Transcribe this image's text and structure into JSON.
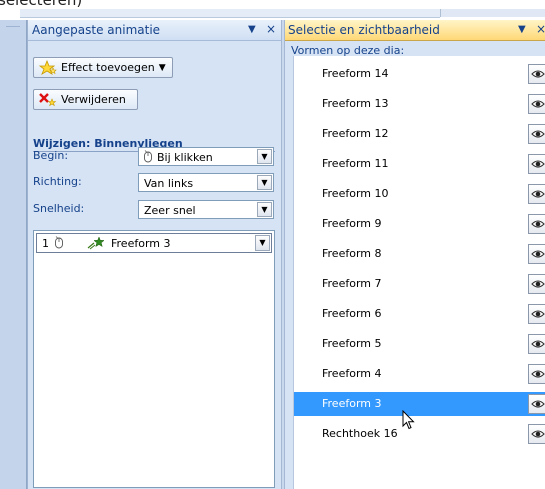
{
  "top_strip": {
    "cut_text": "selecteren)"
  },
  "animation_pane": {
    "title": "Aangepaste animatie",
    "add_effect_label": "Effect toevoegen",
    "remove_label": "Verwijderen",
    "section_title": "Wijzigen: Binnenvliegen",
    "properties": [
      {
        "label": "Begin:",
        "value": "Bij klikken"
      },
      {
        "label": "Richting:",
        "value": "Van links"
      },
      {
        "label": "Snelheid:",
        "value": "Zeer snel"
      }
    ],
    "effects": [
      {
        "number": "1",
        "name": "Freeform 3"
      }
    ]
  },
  "selection_pane": {
    "title": "Selectie en zichtbaarheid",
    "subtitle": "Vormen op deze dia:",
    "shapes": [
      {
        "name": "Freeform 14",
        "selected": false
      },
      {
        "name": "Freeform 13",
        "selected": false
      },
      {
        "name": "Freeform 12",
        "selected": false
      },
      {
        "name": "Freeform 11",
        "selected": false
      },
      {
        "name": "Freeform 10",
        "selected": false
      },
      {
        "name": "Freeform 9",
        "selected": false
      },
      {
        "name": "Freeform 8",
        "selected": false
      },
      {
        "name": "Freeform 7",
        "selected": false
      },
      {
        "name": "Freeform 6",
        "selected": false
      },
      {
        "name": "Freeform 5",
        "selected": false
      },
      {
        "name": "Freeform 4",
        "selected": false
      },
      {
        "name": "Freeform 3",
        "selected": true
      },
      {
        "name": "Rechthoek 16",
        "selected": false
      }
    ]
  },
  "icons": {
    "add_effect": "star-effect-icon",
    "remove": "remove-effect-icon",
    "mouse": "mouse-click-icon",
    "effect": "fly-in-star-icon",
    "visibility": "eye-icon",
    "pane_options": "chevron-down-icon",
    "close": "close-icon"
  },
  "colors": {
    "pane_background": "#d6e3f4",
    "header_text": "#15428b",
    "selection_header": "#ffd877",
    "selected_row": "#3399ff"
  }
}
